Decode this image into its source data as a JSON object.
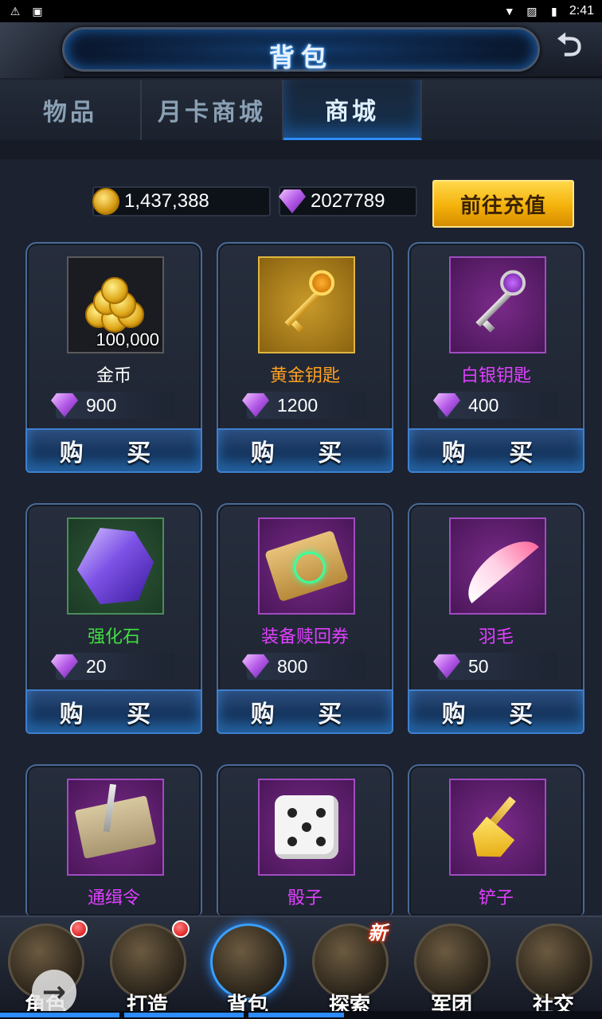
{
  "status_bar": {
    "time": "2:41"
  },
  "header": {
    "title": "背包"
  },
  "tabs": [
    {
      "label": "物品",
      "active": false
    },
    {
      "label": "月卡商城",
      "active": false
    },
    {
      "label": "商城",
      "active": true
    }
  ],
  "currency": {
    "gold": "1,437,388",
    "gems": "2027789"
  },
  "recharge_label": "前往充值",
  "shop_items": [
    {
      "name": "金币",
      "name_color": "#ffffff",
      "frame": "neutral",
      "icon": "gold-coins-icon",
      "quantity": "100,000",
      "price": "900",
      "buy_label": "购 买"
    },
    {
      "name": "黄金钥匙",
      "name_color": "#ffa020",
      "frame": "gold",
      "icon": "golden-key-icon",
      "quantity": "",
      "price": "1200",
      "buy_label": "购 买"
    },
    {
      "name": "白银钥匙",
      "name_color": "#e040ff",
      "frame": "purple",
      "icon": "silver-key-icon",
      "quantity": "",
      "price": "400",
      "buy_label": "购 买"
    },
    {
      "name": "强化石",
      "name_color": "#40e040",
      "frame": "green",
      "icon": "enhancement-stone-icon",
      "quantity": "",
      "price": "20",
      "buy_label": "购 买"
    },
    {
      "name": "装备赎回券",
      "name_color": "#e040ff",
      "frame": "purple",
      "icon": "redemption-scroll-icon",
      "quantity": "",
      "price": "800",
      "buy_label": "购 买"
    },
    {
      "name": "羽毛",
      "name_color": "#e040ff",
      "frame": "purple",
      "icon": "feather-icon",
      "quantity": "",
      "price": "50",
      "buy_label": "购 买"
    },
    {
      "name": "通缉令",
      "name_color": "#e040ff",
      "frame": "purple",
      "icon": "wanted-poster-icon",
      "quantity": "",
      "price": "",
      "buy_label": ""
    },
    {
      "name": "骰子",
      "name_color": "#e040ff",
      "frame": "purple",
      "icon": "dice-icon",
      "quantity": "",
      "price": "",
      "buy_label": ""
    },
    {
      "name": "铲子",
      "name_color": "#e040ff",
      "frame": "purple",
      "icon": "shovel-icon",
      "quantity": "",
      "price": "",
      "buy_label": ""
    }
  ],
  "bottom_nav": [
    {
      "label": "角色",
      "icon": "helmet-icon",
      "badge": "red-dot",
      "active": false
    },
    {
      "label": "打造",
      "icon": "anvil-icon",
      "badge": "red-dot",
      "active": false
    },
    {
      "label": "背包",
      "icon": "backpack-icon",
      "badge": "",
      "active": true
    },
    {
      "label": "探索",
      "icon": "explore-icon",
      "badge": "新",
      "active": false
    },
    {
      "label": "军团",
      "icon": "shield-icon",
      "badge": "",
      "active": false
    },
    {
      "label": "社交",
      "icon": "mail-icon",
      "badge": "",
      "active": false
    }
  ],
  "colors": {
    "accent_blue": "#2d8cff",
    "recharge_gold": "#f4b20a",
    "gem_purple": "#b45be8"
  }
}
